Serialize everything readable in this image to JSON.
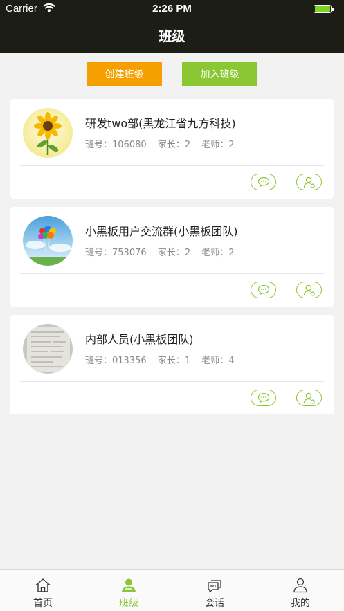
{
  "status_bar": {
    "carrier": "Carrier",
    "time": "2:26 PM"
  },
  "nav": {
    "title": "班级"
  },
  "actions": {
    "create_label": "创建班级",
    "join_label": "加入班级"
  },
  "labels": {
    "class_no": "班号：",
    "parents": "家长：",
    "teachers": "老师："
  },
  "classes": [
    {
      "name": "研发two部(黑龙江省九方科技)",
      "class_no": "106080",
      "parents": "2",
      "teachers": "2",
      "avatar": "sunflower-image"
    },
    {
      "name": "小黑板用户交流群(小黑板团队)",
      "class_no": "753076",
      "parents": "2",
      "teachers": "2",
      "avatar": "balloons-image"
    },
    {
      "name": "内部人员(小黑板团队)",
      "class_no": "013356",
      "parents": "1",
      "teachers": "4",
      "avatar": "document-image"
    }
  ],
  "tabs": [
    {
      "label": "首页",
      "icon": "home-icon"
    },
    {
      "label": "班级",
      "icon": "class-icon",
      "active": true
    },
    {
      "label": "会话",
      "icon": "chat-icon"
    },
    {
      "label": "我的",
      "icon": "profile-icon"
    }
  ],
  "colors": {
    "header": "#1c1e16",
    "accent": "#8bc732",
    "orange": "#f5a000"
  }
}
